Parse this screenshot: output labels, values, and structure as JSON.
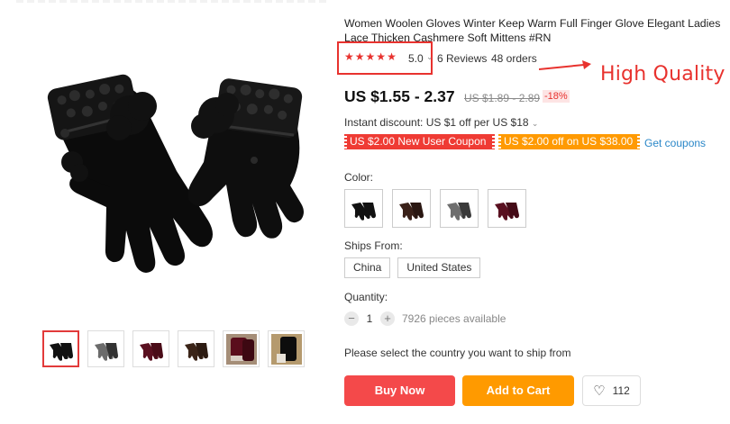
{
  "product": {
    "title": "Women Woolen Gloves Winter Keep Warm Full Finger Glove Elegant Ladies Lace Thicken Cashmere Soft Mittens #RN",
    "rating": "5.0",
    "stars": 5,
    "reviews": "6 Reviews",
    "orders": "48 orders",
    "annotation": "High Quality",
    "price": "US $1.55 - 2.37",
    "old_price": "US $1.89 - 2.89",
    "discount": "-18%",
    "instant_discount": "Instant discount: US $1 off per US $18",
    "coupons": [
      "US $2.00 New User Coupon",
      "US $2.00 off on US $38.00"
    ],
    "get_coupons": "Get coupons",
    "color_label": "Color:",
    "color_options": [
      "black",
      "brown",
      "gray",
      "wine-red"
    ],
    "ships_from_label": "Ships From:",
    "ships_from": [
      "China",
      "United States"
    ],
    "quantity_label": "Quantity:",
    "quantity": "1",
    "minus": "−",
    "plus": "+",
    "available": "7926 pieces available",
    "select_country": "Please select the country you want to ship from",
    "buy_now": "Buy Now",
    "add_to_cart": "Add to Cart",
    "wishlist_count": "112"
  },
  "colors": {
    "star": "#e8322e",
    "buy_now": "#f4494a",
    "add_to_cart": "#ff9a00",
    "coupon_red": "#ef3b34",
    "coupon_orange": "#ff9a02",
    "link": "#2a87c8"
  },
  "thumbnails": [
    "black",
    "gray",
    "wine-red",
    "brown",
    "wine-red-cuff",
    "black-cuff"
  ]
}
